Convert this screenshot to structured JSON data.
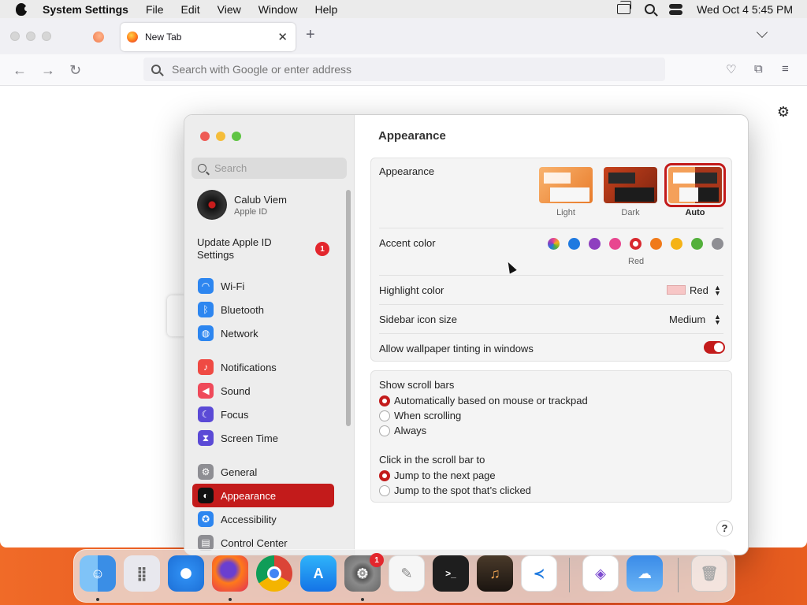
{
  "menubar": {
    "app": "System Settings",
    "items": [
      "File",
      "Edit",
      "View",
      "Window",
      "Help"
    ],
    "datetime": "Wed Oct 4  5:45 PM"
  },
  "browser": {
    "tab_title": "New Tab",
    "address_placeholder": "Search with Google or enter address"
  },
  "settings": {
    "search_placeholder": "Search",
    "user": {
      "name": "Calub Viem",
      "subtitle": "Apple ID"
    },
    "update": {
      "label": "Update Apple ID Settings",
      "count": "1"
    },
    "sidebar": [
      {
        "label": "Wi-Fi",
        "icon": "wifi-icon",
        "color": "#2d86f0"
      },
      {
        "label": "Bluetooth",
        "icon": "bluetooth-icon",
        "color": "#2d86f0"
      },
      {
        "label": "Network",
        "icon": "globe-icon",
        "color": "#2d86f0"
      },
      {
        "label": "Notifications",
        "icon": "bell-icon",
        "color": "#ef4a43"
      },
      {
        "label": "Sound",
        "icon": "speaker-icon",
        "color": "#ef4a5a"
      },
      {
        "label": "Focus",
        "icon": "moon-icon",
        "color": "#5b4ad6"
      },
      {
        "label": "Screen Time",
        "icon": "hourglass-icon",
        "color": "#5b4ad6"
      },
      {
        "label": "General",
        "icon": "gear-icon",
        "color": "#8e8e93"
      },
      {
        "label": "Appearance",
        "icon": "appearance-icon",
        "color": "#111111",
        "selected": true
      },
      {
        "label": "Accessibility",
        "icon": "accessibility-icon",
        "color": "#2d86f0"
      },
      {
        "label": "Control Center",
        "icon": "control-center-icon",
        "color": "#8e8e93"
      }
    ],
    "title": "Appearance",
    "appearance": {
      "label": "Appearance",
      "options": [
        "Light",
        "Dark",
        "Auto"
      ],
      "selected": "Auto"
    },
    "accent": {
      "label": "Accent color",
      "colors": [
        "multicolor",
        "#1f7ae0",
        "#8e3fbf",
        "#e8478f",
        "#d8292f",
        "#f07a1a",
        "#f5b316",
        "#53b03b",
        "#8e8e93"
      ],
      "selected_name": "Red"
    },
    "highlight": {
      "label": "Highlight color",
      "value": "Red"
    },
    "sidebar_icon_size": {
      "label": "Sidebar icon size",
      "value": "Medium"
    },
    "wallpaper_tint": {
      "label": "Allow wallpaper tinting in windows",
      "on": true
    },
    "scroll_bars": {
      "label": "Show scroll bars",
      "options": [
        "Automatically based on mouse or trackpad",
        "When scrolling",
        "Always"
      ],
      "selected": 0
    },
    "click_scroll": {
      "label": "Click in the scroll bar to",
      "options": [
        "Jump to the next page",
        "Jump to the spot that’s clicked"
      ],
      "selected": 0
    },
    "help": "?"
  },
  "dock": {
    "apps": [
      "Finder",
      "Launchpad",
      "Safari",
      "Firefox",
      "Chrome",
      "App Store",
      "System Settings",
      "TextEdit",
      "Terminal",
      "GarageBand",
      "VS Code",
      "Visual Studio",
      "Weather",
      "Trash"
    ],
    "settings_badge": "1"
  }
}
